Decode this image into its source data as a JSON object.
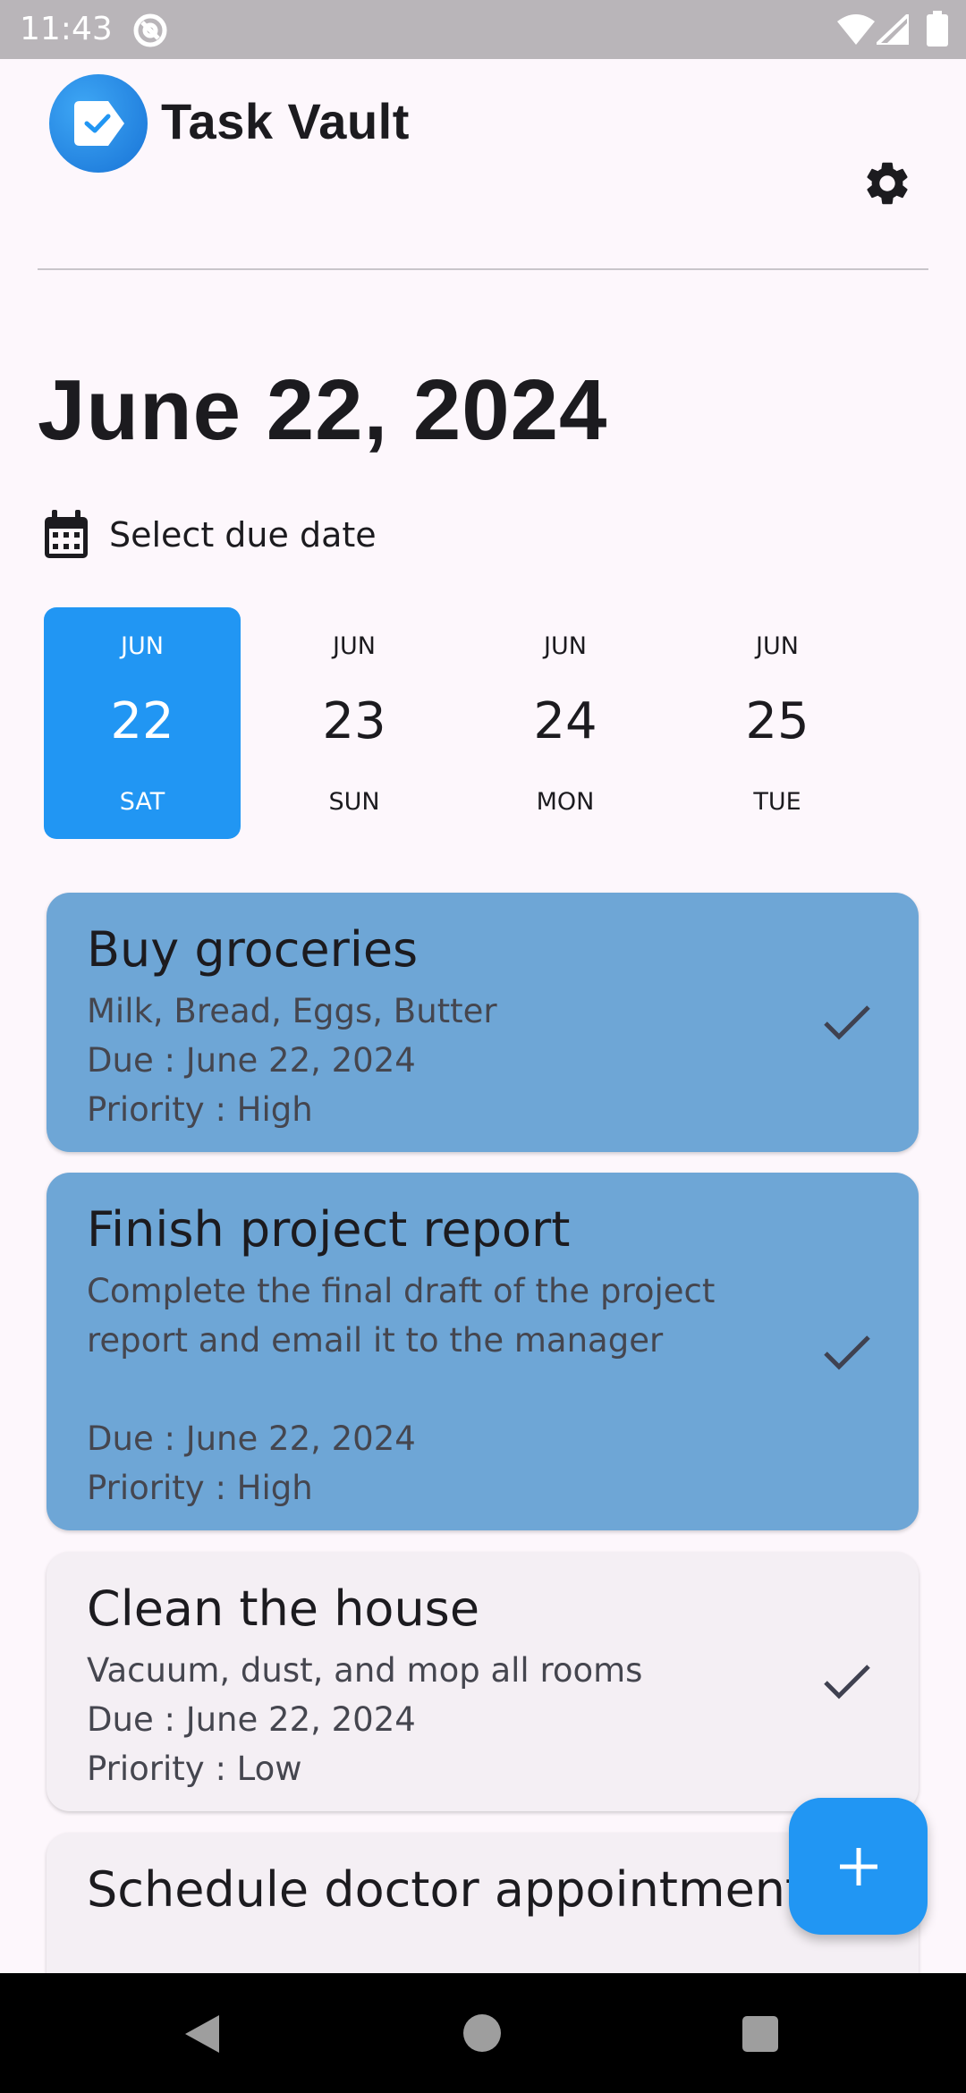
{
  "status_bar": {
    "time": "11:43",
    "icons": [
      "at-sign-icon",
      "wifi-icon",
      "signal-icon",
      "battery-icon"
    ]
  },
  "app_bar": {
    "title": "Task Vault",
    "logo_icon": "tag-check-icon",
    "settings_icon": "gear-icon"
  },
  "page": {
    "date_heading": "June 22, 2024"
  },
  "due_selector": {
    "label": "Select due date",
    "icon": "calendar-icon"
  },
  "date_strip": [
    {
      "month": "JUN",
      "day": "22",
      "weekday": "SAT",
      "selected": true
    },
    {
      "month": "JUN",
      "day": "23",
      "weekday": "SUN",
      "selected": false
    },
    {
      "month": "JUN",
      "day": "24",
      "weekday": "MON",
      "selected": false
    },
    {
      "month": "JUN",
      "day": "25",
      "weekday": "TUE",
      "selected": false
    }
  ],
  "tasks": [
    {
      "title": "Buy groceries",
      "description": "Milk, Bread, Eggs, Butter",
      "due": "Due : June 22, 2024",
      "priority": "Priority : High"
    },
    {
      "title": "Finish project report",
      "description": "Complete the final draft of the project report and email it to the manager",
      "due": "Due : June 22, 2024",
      "priority": "Priority : High"
    },
    {
      "title": "Clean the house",
      "description": "Vacuum, dust, and mop all rooms",
      "due": "Due : June 22, 2024",
      "priority": "Priority : Low"
    },
    {
      "title": "Schedule doctor appointment"
    }
  ],
  "fab": {
    "icon": "plus-icon"
  },
  "colors": {
    "accent": "#2196f3",
    "high_priority_card": "#6ea6d6",
    "card_bg": "#f4eff4",
    "page_bg": "#fdf7fc"
  }
}
